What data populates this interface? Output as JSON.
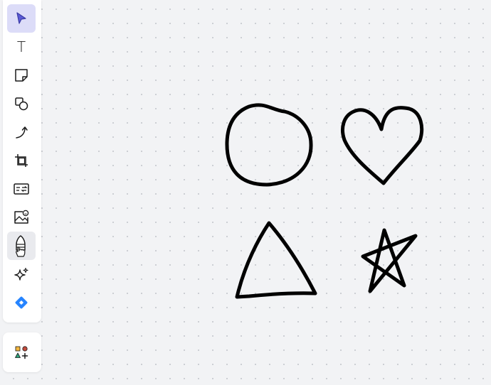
{
  "toolbar": {
    "tools": [
      {
        "name": "select",
        "icon": "pointer-icon",
        "state": "active"
      },
      {
        "name": "text",
        "icon": "text-icon",
        "glyph": "T"
      },
      {
        "name": "sticky-note",
        "icon": "sticky-note-icon"
      },
      {
        "name": "shapes",
        "icon": "shapes-icon"
      },
      {
        "name": "connection-line",
        "icon": "arrow-curve-icon"
      },
      {
        "name": "frame",
        "icon": "frame-icon"
      },
      {
        "name": "card",
        "icon": "card-icon"
      },
      {
        "name": "upload",
        "icon": "image-upload-icon"
      },
      {
        "name": "pen",
        "icon": "pen-icon",
        "state": "hover"
      },
      {
        "name": "ai",
        "icon": "sparkle-icon"
      },
      {
        "name": "jira",
        "icon": "jira-icon"
      }
    ],
    "apps": {
      "icon": "apps-icon"
    }
  },
  "colors": {
    "canvas_background": "#f2f3f5",
    "grid_dot": "#c3c6cc",
    "active_tool_bg": "#dcdcf8",
    "hover_tool_bg": "#e9eaee",
    "accent": "#5b5bd6",
    "stroke": "#000000",
    "jira_blue": "#2684ff"
  },
  "canvas": {
    "drawings": [
      {
        "name": "circle-drawing",
        "shape": "circle"
      },
      {
        "name": "heart-drawing",
        "shape": "heart"
      },
      {
        "name": "triangle-drawing",
        "shape": "triangle"
      },
      {
        "name": "star-drawing",
        "shape": "star"
      }
    ]
  }
}
